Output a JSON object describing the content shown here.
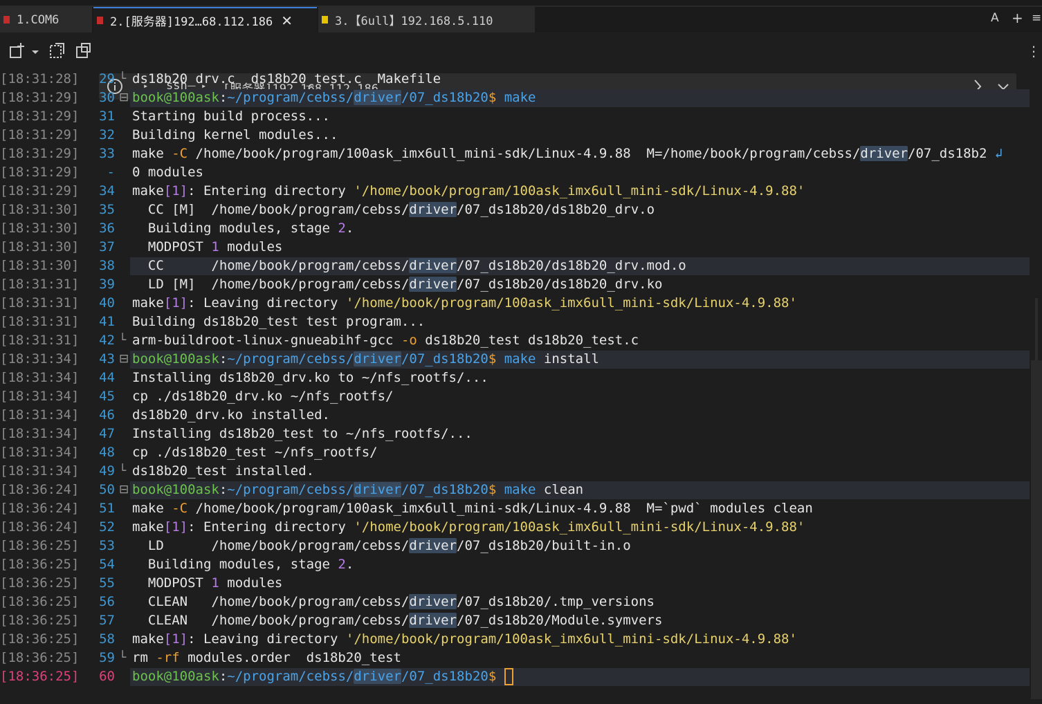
{
  "tabs": [
    {
      "label": "1.COM6",
      "color": "#c42b2b"
    },
    {
      "label": "2.[服务器]192…68.112.186",
      "color": "#c42b2b",
      "close": "✕"
    },
    {
      "label": "3.【6ull】192.168.5.110",
      "color": "#e6c200"
    }
  ],
  "tabbar_right": {
    "font": "A",
    "add": "+",
    "menu": "≡"
  },
  "address": {
    "ssh": "ssh",
    "host": "[服务器]192.168.112.186"
  },
  "lines": [
    {
      "ts": "[18:31:28]",
      "ln": "29",
      "fold": "└",
      "segs": [
        [
          "ds18b20_drv.c  ds18b20_test.c  Makefile",
          "w"
        ]
      ]
    },
    {
      "ts": "[18:31:29]",
      "ln": "30",
      "fold": "⊟",
      "hl": true,
      "segs": [
        [
          "book@100ask",
          "g"
        ],
        [
          ":",
          "w"
        ],
        [
          "~/program/cebss/",
          "b"
        ],
        [
          "driver",
          "bd"
        ],
        [
          "/07_ds18b20",
          "b"
        ],
        [
          "$ ",
          "o"
        ],
        [
          "make",
          "b"
        ]
      ]
    },
    {
      "ts": "[18:31:29]",
      "ln": "31",
      "fold": "",
      "segs": [
        [
          "Starting build process...",
          "w"
        ]
      ]
    },
    {
      "ts": "[18:31:29]",
      "ln": "32",
      "fold": "",
      "segs": [
        [
          "Building kernel modules...",
          "w"
        ]
      ]
    },
    {
      "ts": "[18:31:29]",
      "ln": "33",
      "fold": "",
      "segs": [
        [
          "make ",
          "w"
        ],
        [
          "-C",
          "o"
        ],
        [
          " /home/book/program/100ask_imx6ull_mini-sdk/Linux-4.9.88  M=/home/book/program/cebss/",
          "w"
        ],
        [
          "driver",
          "wd"
        ],
        [
          "/07_ds18b2 ",
          "w"
        ],
        [
          "↲",
          "b"
        ]
      ]
    },
    {
      "ts": "[18:31:29]",
      "ln": "-",
      "fold": "",
      "segs": [
        [
          "0 modules",
          "w"
        ]
      ]
    },
    {
      "ts": "[18:31:29]",
      "ln": "34",
      "fold": "",
      "segs": [
        [
          "make",
          "w"
        ],
        [
          "[1]",
          "p"
        ],
        [
          ": Entering directory ",
          "w"
        ],
        [
          "'/home/book/program/100ask_imx6ull_mini-sdk/Linux-4.9.88'",
          "y"
        ]
      ]
    },
    {
      "ts": "[18:31:30]",
      "ln": "35",
      "fold": "",
      "segs": [
        [
          "  CC ",
          "w"
        ],
        [
          "[M]",
          "w"
        ],
        [
          "  /home/book/program/cebss/",
          "w"
        ],
        [
          "driver",
          "wd"
        ],
        [
          "/07_ds18b20/ds18b20_drv.o",
          "w"
        ]
      ]
    },
    {
      "ts": "[18:31:30]",
      "ln": "36",
      "fold": "",
      "segs": [
        [
          "  Building modules, stage ",
          "w"
        ],
        [
          "2",
          "p"
        ],
        [
          ".",
          "w"
        ]
      ]
    },
    {
      "ts": "[18:31:30]",
      "ln": "37",
      "fold": "",
      "segs": [
        [
          "  MODPOST ",
          "w"
        ],
        [
          "1",
          "p"
        ],
        [
          " modules",
          "w"
        ]
      ]
    },
    {
      "ts": "[18:31:30]",
      "ln": "38",
      "fold": "",
      "hl": true,
      "segs": [
        [
          "  CC      /home/book/program/cebss/",
          "w"
        ],
        [
          "driver",
          "wd"
        ],
        [
          "/07_ds18b20/ds18b20_drv.mod.o",
          "w"
        ]
      ]
    },
    {
      "ts": "[18:31:31]",
      "ln": "39",
      "fold": "",
      "segs": [
        [
          "  LD ",
          "w"
        ],
        [
          "[M]",
          "w"
        ],
        [
          "  /home/book/program/cebss/",
          "w"
        ],
        [
          "driver",
          "wd"
        ],
        [
          "/07_ds18b20/ds18b20_drv.ko",
          "w"
        ]
      ]
    },
    {
      "ts": "[18:31:31]",
      "ln": "40",
      "fold": "",
      "segs": [
        [
          "make",
          "w"
        ],
        [
          "[1]",
          "p"
        ],
        [
          ": Leaving directory ",
          "w"
        ],
        [
          "'/home/book/program/100ask_imx6ull_mini-sdk/Linux-4.9.88'",
          "y"
        ]
      ]
    },
    {
      "ts": "[18:31:31]",
      "ln": "41",
      "fold": "",
      "segs": [
        [
          "Building ds18b20_test test program...",
          "w"
        ]
      ]
    },
    {
      "ts": "[18:31:31]",
      "ln": "42",
      "fold": "└",
      "segs": [
        [
          "arm-buildroot-linux-gnueabihf-gcc ",
          "w"
        ],
        [
          "-o",
          "o"
        ],
        [
          " ds18b20_test ds18b20_test.c",
          "w"
        ]
      ]
    },
    {
      "ts": "[18:31:34]",
      "ln": "43",
      "fold": "⊟",
      "hl": true,
      "segs": [
        [
          "book@100ask",
          "g"
        ],
        [
          ":",
          "w"
        ],
        [
          "~/program/cebss/",
          "b"
        ],
        [
          "driver",
          "bd"
        ],
        [
          "/07_ds18b20",
          "b"
        ],
        [
          "$ ",
          "o"
        ],
        [
          "make",
          "b"
        ],
        [
          " install",
          "w"
        ]
      ]
    },
    {
      "ts": "[18:31:34]",
      "ln": "44",
      "fold": "",
      "segs": [
        [
          "Installing ds18b20_drv.ko to ~/nfs_rootfs/...",
          "w"
        ]
      ]
    },
    {
      "ts": "[18:31:34]",
      "ln": "45",
      "fold": "",
      "segs": [
        [
          "cp ./ds18b20_drv.ko ~/nfs_rootfs/",
          "w"
        ]
      ]
    },
    {
      "ts": "[18:31:34]",
      "ln": "46",
      "fold": "",
      "segs": [
        [
          "ds18b20_drv.ko installed.",
          "w"
        ]
      ]
    },
    {
      "ts": "[18:31:34]",
      "ln": "47",
      "fold": "",
      "segs": [
        [
          "Installing ds18b20_test to ~/nfs_rootfs/...",
          "w"
        ]
      ]
    },
    {
      "ts": "[18:31:34]",
      "ln": "48",
      "fold": "",
      "segs": [
        [
          "cp ./ds18b20_test ~/nfs_rootfs/",
          "w"
        ]
      ]
    },
    {
      "ts": "[18:31:34]",
      "ln": "49",
      "fold": "└",
      "segs": [
        [
          "ds18b20_test installed.",
          "w"
        ]
      ]
    },
    {
      "ts": "[18:36:24]",
      "ln": "50",
      "fold": "⊟",
      "hl": true,
      "segs": [
        [
          "book@100ask",
          "g"
        ],
        [
          ":",
          "w"
        ],
        [
          "~/program/cebss/",
          "b"
        ],
        [
          "driver",
          "bd"
        ],
        [
          "/07_ds18b20",
          "b"
        ],
        [
          "$ ",
          "o"
        ],
        [
          "make",
          "b"
        ],
        [
          " clean",
          "w"
        ]
      ]
    },
    {
      "ts": "[18:36:24]",
      "ln": "51",
      "fold": "",
      "segs": [
        [
          "make ",
          "w"
        ],
        [
          "-C",
          "o"
        ],
        [
          " /home/book/program/100ask_imx6ull_mini-sdk/Linux-4.9.88  M=`pwd` modules clean",
          "w"
        ]
      ]
    },
    {
      "ts": "[18:36:24]",
      "ln": "52",
      "fold": "",
      "segs": [
        [
          "make",
          "w"
        ],
        [
          "[1]",
          "p"
        ],
        [
          ": Entering directory ",
          "w"
        ],
        [
          "'/home/book/program/100ask_imx6ull_mini-sdk/Linux-4.9.88'",
          "y"
        ]
      ]
    },
    {
      "ts": "[18:36:25]",
      "ln": "53",
      "fold": "",
      "segs": [
        [
          "  LD      /home/book/program/cebss/",
          "w"
        ],
        [
          "driver",
          "wd"
        ],
        [
          "/07_ds18b20/built-in.o",
          "w"
        ]
      ]
    },
    {
      "ts": "[18:36:25]",
      "ln": "54",
      "fold": "",
      "segs": [
        [
          "  Building modules, stage ",
          "w"
        ],
        [
          "2",
          "p"
        ],
        [
          ".",
          "w"
        ]
      ]
    },
    {
      "ts": "[18:36:25]",
      "ln": "55",
      "fold": "",
      "segs": [
        [
          "  MODPOST ",
          "w"
        ],
        [
          "1",
          "p"
        ],
        [
          " modules",
          "w"
        ]
      ]
    },
    {
      "ts": "[18:36:25]",
      "ln": "56",
      "fold": "",
      "segs": [
        [
          "  CLEAN   /home/book/program/cebss/",
          "w"
        ],
        [
          "driver",
          "wd"
        ],
        [
          "/07_ds18b20/.tmp_versions",
          "w"
        ]
      ]
    },
    {
      "ts": "[18:36:25]",
      "ln": "57",
      "fold": "",
      "segs": [
        [
          "  CLEAN   /home/book/program/cebss/",
          "w"
        ],
        [
          "driver",
          "wd"
        ],
        [
          "/07_ds18b20/Module.symvers",
          "w"
        ]
      ]
    },
    {
      "ts": "[18:36:25]",
      "ln": "58",
      "fold": "",
      "segs": [
        [
          "make",
          "w"
        ],
        [
          "[1]",
          "p"
        ],
        [
          ": Leaving directory ",
          "w"
        ],
        [
          "'/home/book/program/100ask_imx6ull_mini-sdk/Linux-4.9.88'",
          "y"
        ]
      ]
    },
    {
      "ts": "[18:36:25]",
      "ln": "59",
      "fold": "└",
      "segs": [
        [
          "rm ",
          "w"
        ],
        [
          "-rf",
          "o"
        ],
        [
          " modules.order  ds18b20_test",
          "w"
        ]
      ]
    },
    {
      "ts": "[18:36:25]",
      "ln": "60",
      "fold": "",
      "current": true,
      "hl": true,
      "segs": [
        [
          "book@100ask",
          "g"
        ],
        [
          ":",
          "w"
        ],
        [
          "~/program/cebss/",
          "b"
        ],
        [
          "driver",
          "bd"
        ],
        [
          "/07_ds18b20",
          "b"
        ],
        [
          "$ ",
          "o"
        ]
      ]
    }
  ]
}
